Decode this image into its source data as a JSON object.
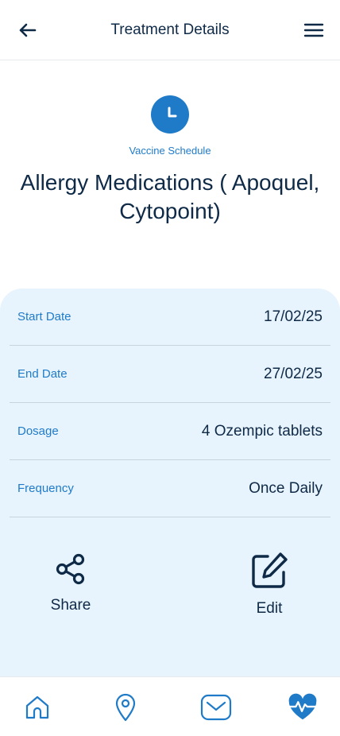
{
  "header": {
    "title": "Treatment Details",
    "back_icon": "arrow-left-icon",
    "menu_icon": "hamburger-menu-icon"
  },
  "hero": {
    "icon": "clock-icon",
    "subtitle": "Vaccine Schedule",
    "title": "Allergy Medications ( Apoquel, Cytopoint)"
  },
  "details": [
    {
      "label": "Start Date",
      "value": "17/02/25"
    },
    {
      "label": "End Date",
      "value": "27/02/25"
    },
    {
      "label": "Dosage",
      "value": "4 Ozempic tablets"
    },
    {
      "label": "Frequency",
      "value": "Once Daily"
    }
  ],
  "actions": {
    "share": {
      "label": "Share",
      "icon": "share-icon"
    },
    "edit": {
      "label": "Edit",
      "icon": "edit-icon"
    }
  },
  "bottom_nav": {
    "items": [
      {
        "name": "home",
        "icon": "home-icon"
      },
      {
        "name": "location",
        "icon": "map-pin-icon"
      },
      {
        "name": "messages",
        "icon": "mail-icon"
      },
      {
        "name": "health",
        "icon": "heart-pulse-icon",
        "active": true
      }
    ]
  },
  "colors": {
    "accent": "#1f7bc8",
    "text_dark": "#0f2a47",
    "card_bg": "#e7f3fd",
    "nav_icon": "#1f7bc8"
  }
}
